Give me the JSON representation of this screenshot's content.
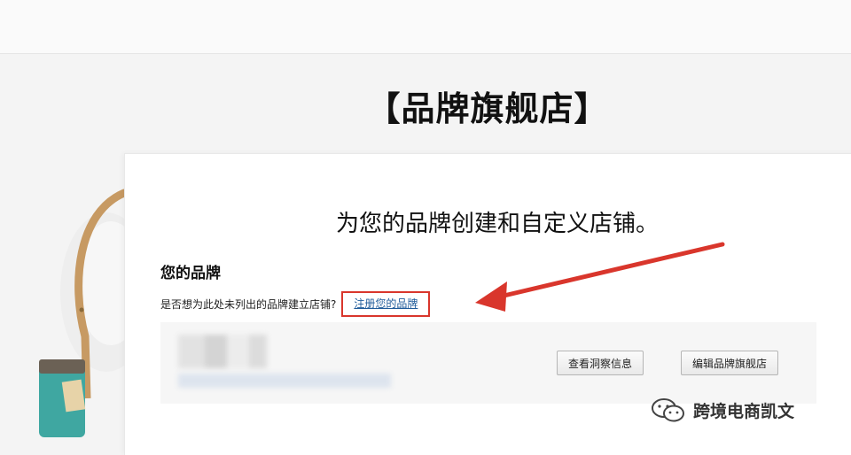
{
  "page": {
    "title": "【品牌旗舰店】"
  },
  "card": {
    "heading": "为您的品牌创建和自定义店铺。",
    "section_title": "您的品牌",
    "question": "是否想为此处未列出的品牌建立店铺?",
    "register_link": "注册您的品牌"
  },
  "brand_entry": {
    "view_insights_label": "查看洞察信息",
    "edit_store_label": "编辑品牌旗舰店"
  },
  "watermark": {
    "text": "跨境电商凯文"
  },
  "colors": {
    "highlight_red": "#d9362c",
    "link_blue": "#1f5b9a"
  }
}
